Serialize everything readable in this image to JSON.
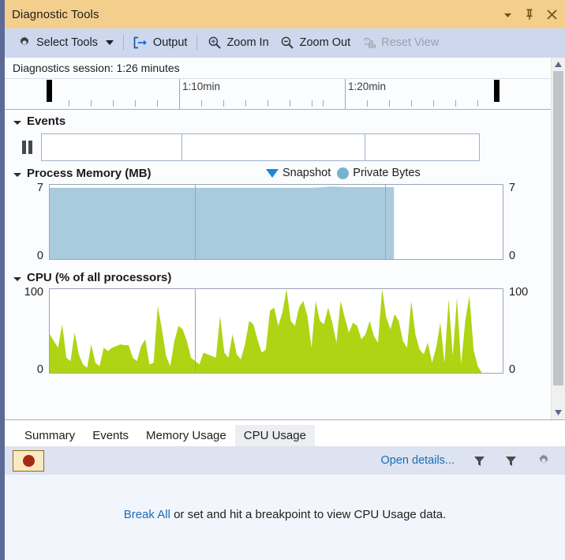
{
  "window": {
    "title": "Diagnostic Tools",
    "buttons": [
      {
        "name": "dropdown-button",
        "icon": "chevron-down-icon"
      },
      {
        "name": "pin-button",
        "icon": "pin-icon"
      },
      {
        "name": "close-button",
        "icon": "close-icon"
      }
    ]
  },
  "toolbar": {
    "select_tools": "Select Tools",
    "output": "Output",
    "zoom_in": "Zoom In",
    "zoom_out": "Zoom Out",
    "reset_view": "Reset View"
  },
  "session": {
    "label": "Diagnostics session: 1:26 minutes"
  },
  "ruler": {
    "labels": [
      "1:10min",
      "1:20min"
    ]
  },
  "events": {
    "title": "Events"
  },
  "memory": {
    "title": "Process Memory (MB)",
    "legend": [
      {
        "label": "Snapshot",
        "icon": "snapshot-triangle-icon",
        "color": "#1f86d0"
      },
      {
        "label": "Private Bytes",
        "icon": "private-bytes-dot-icon",
        "color": "#74b3d0"
      }
    ],
    "axis_max": "7",
    "axis_min": "0"
  },
  "cpu": {
    "title": "CPU (% of all processors)",
    "axis_max": "100",
    "axis_min": "0"
  },
  "tabs": [
    {
      "label": "Summary",
      "active": false
    },
    {
      "label": "Events",
      "active": false
    },
    {
      "label": "Memory Usage",
      "active": false
    },
    {
      "label": "CPU Usage",
      "active": true
    }
  ],
  "subtoolbar": {
    "record_button": "record-button",
    "open_details": "Open details...",
    "filter_icon_1": "filter-icon",
    "filter_icon_2": "filter-icon",
    "settings_icon": "gear-icon"
  },
  "bottom_panel": {
    "link_text": "Break All",
    "rest_text": " or set and hit a breakpoint to view CPU Usage data."
  },
  "colors": {
    "titlebar": "#f4ce8c",
    "toolbar": "#cdd8ef",
    "memory_fill": "#a8cbdd",
    "cpu_fill": "#aed413",
    "link": "#1a6bb8",
    "window_border": "#5b6b96"
  },
  "chart_data": [
    {
      "type": "area",
      "title": "Process Memory (MB)",
      "ylabel": "MB",
      "ylim": [
        0,
        7
      ],
      "grid": false,
      "legend": [
        "Snapshot",
        "Private Bytes"
      ],
      "series": [
        {
          "name": "Private Bytes",
          "values": [
            6.78,
            6.78,
            6.78,
            6.78,
            6.78,
            6.78,
            6.78,
            6.78,
            6.78,
            6.78,
            6.78,
            6.78,
            6.78,
            6.78,
            6.78,
            6.78,
            6.78,
            6.78,
            6.78,
            6.78,
            6.78,
            6.78,
            6.78,
            6.78,
            6.78,
            6.78,
            6.78,
            6.78,
            6.78,
            6.78,
            6.78,
            6.78,
            6.78,
            6.78,
            6.78,
            6.78,
            6.78,
            6.78,
            6.78,
            6.78,
            6.78,
            6.78,
            6.78,
            6.78,
            6.78,
            6.78,
            6.78,
            6.78,
            6.78,
            6.78,
            6.78,
            6.78,
            6.78,
            6.78,
            6.78,
            6.78,
            6.78,
            6.78,
            6.78,
            6.78,
            6.78,
            6.78,
            6.78,
            6.78,
            6.88,
            6.92,
            6.9,
            6.88,
            6.88,
            6.88,
            6.88,
            6.88,
            6.88,
            6.88,
            6.88,
            6.88,
            6.88,
            6.88,
            6.88,
            6.88,
            0,
            0,
            0,
            0,
            0,
            0,
            0,
            0,
            0,
            0
          ]
        }
      ]
    },
    {
      "type": "area",
      "title": "CPU (% of all processors)",
      "ylabel": "%",
      "ylim": [
        0,
        100
      ],
      "grid": false,
      "series": [
        {
          "name": "CPU",
          "values": [
            46,
            38,
            30,
            58,
            18,
            14,
            48,
            22,
            10,
            6,
            34,
            12,
            8,
            30,
            26,
            30,
            32,
            34,
            33,
            33,
            18,
            14,
            32,
            40,
            10,
            12,
            80,
            52,
            20,
            8,
            38,
            56,
            52,
            38,
            18,
            14,
            10,
            24,
            22,
            20,
            18,
            68,
            24,
            18,
            46,
            22,
            16,
            34,
            62,
            58,
            40,
            24,
            28,
            74,
            78,
            56,
            72,
            100,
            62,
            56,
            78,
            86,
            68,
            30,
            86,
            62,
            58,
            78,
            60,
            36,
            86,
            66,
            48,
            60,
            56,
            40,
            46,
            62,
            44,
            36,
            100,
            66,
            52,
            70,
            62,
            38,
            30,
            86,
            46,
            28,
            22,
            36,
            12,
            30,
            60,
            12,
            88,
            20,
            90,
            10,
            62,
            92,
            28,
            8,
            0,
            0,
            0,
            0,
            0,
            0
          ]
        }
      ]
    }
  ]
}
